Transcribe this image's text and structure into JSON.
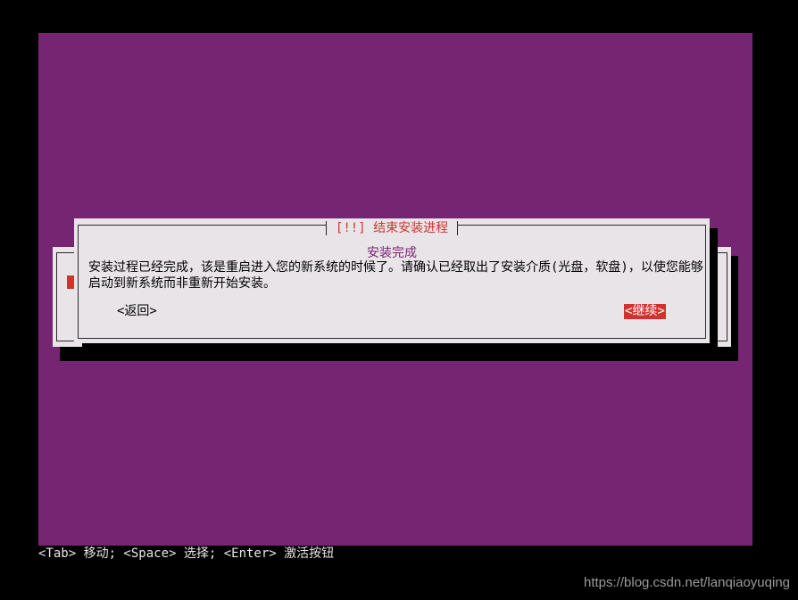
{
  "dialog": {
    "title": "[!!] 结束安装进程",
    "subtitle": "安装完成",
    "message": "安装过程已经完成，该是重启进入您的新系统的时候了。请确认已经取出了安装介质(光盘，软盘)，以使您能够启动到新系统而非重新开始安装。",
    "back_label": "<返回>",
    "continue_label": "<继续>"
  },
  "footer": {
    "hint": "<Tab> 移动; <Space> 选择; <Enter> 激活按钮"
  },
  "watermark": "https://blog.csdn.net/lanqiaoyuqing",
  "colors": {
    "background": "#762572",
    "dialog": "#e9e4e8",
    "accent": "#d2322d",
    "outer": "#000000"
  }
}
